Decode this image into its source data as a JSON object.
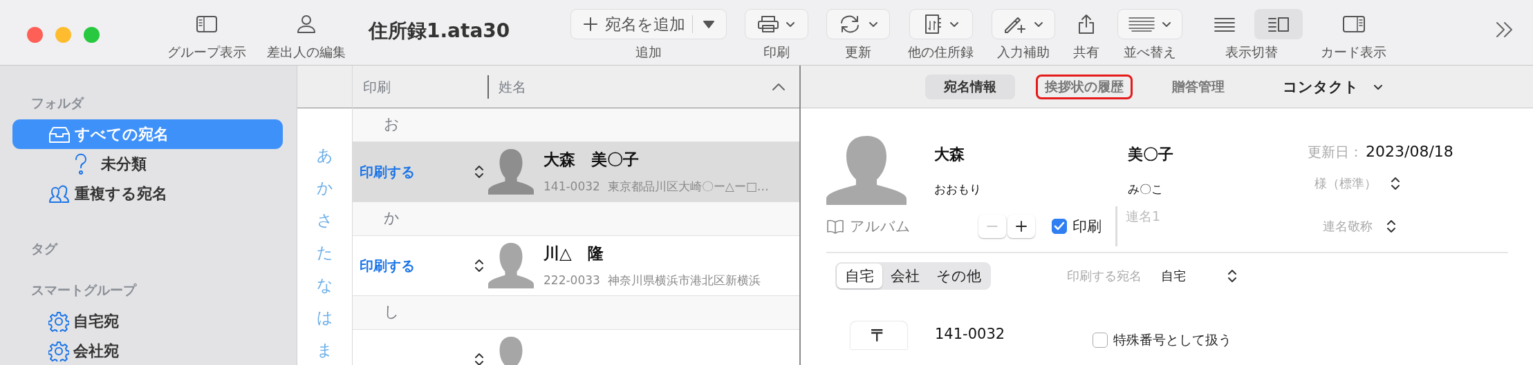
{
  "window": {
    "title": "住所録1.ata30"
  },
  "toolbar": {
    "left_items": [
      {
        "label": "グループ表示"
      },
      {
        "label": "差出人の編集"
      }
    ],
    "items": [
      {
        "kind": "split",
        "button_label": "宛名を追加",
        "label": "追加"
      },
      {
        "kind": "menu",
        "label": "印刷"
      },
      {
        "kind": "menu",
        "label": "更新"
      },
      {
        "kind": "menu",
        "label": "他の住所録"
      },
      {
        "kind": "menu",
        "label": "入力補助"
      },
      {
        "kind": "plain",
        "label": "共有"
      },
      {
        "kind": "menu",
        "label": "並べ替え"
      },
      {
        "kind": "toggle",
        "label": "表示切替",
        "segments": [
          {
            "selected": false
          },
          {
            "selected": true
          }
        ]
      },
      {
        "kind": "plain",
        "label": "カード表示"
      }
    ]
  },
  "sidebar": {
    "sections": [
      {
        "heading": "フォルダ",
        "items": [
          {
            "kind": "all",
            "label": "すべての宛名",
            "selected": true,
            "children": [
              {
                "kind": "unfiled",
                "label": "未分類",
                "selected": false
              }
            ]
          },
          {
            "kind": "duplicates",
            "label": "重複する宛名",
            "selected": false
          }
        ]
      },
      {
        "heading": "タグ"
      },
      {
        "heading": "スマートグループ",
        "items": [
          {
            "kind": "smart",
            "label": "自宅宛",
            "selected": false
          },
          {
            "kind": "smart",
            "label": "会社宛",
            "selected": false
          }
        ]
      }
    ]
  },
  "index_bar": {
    "letters": [
      "あ",
      "か",
      "さ",
      "た",
      "な",
      "は",
      "ま"
    ]
  },
  "list": {
    "columns": [
      "印刷",
      "姓名"
    ],
    "groups": [
      {
        "letter": "お",
        "rows": [
          {
            "print": "印刷する",
            "name": "大森　美〇子",
            "address": "141-0032  東京都品川区大崎〇ー△ー□…",
            "selected": true
          }
        ]
      },
      {
        "letter": "か",
        "rows": [
          {
            "print": "印刷する",
            "name": "川△　隆",
            "address": "222-0033  神奈川県横浜市港北区新横浜",
            "selected": false
          }
        ]
      },
      {
        "letter": "し",
        "rows": [
          {
            "selected": false
          }
        ]
      }
    ]
  },
  "detail": {
    "tabs": [
      {
        "kind": "tab",
        "label": "宛名情報",
        "selected": true,
        "highlighted": false
      },
      {
        "kind": "tab",
        "label": "挨拶状の履歴",
        "selected": false,
        "highlighted": true
      },
      {
        "kind": "tab",
        "label": "贈答管理",
        "selected": false,
        "highlighted": false
      },
      {
        "kind": "menu",
        "label": "コンタクト",
        "selected": false
      }
    ],
    "last_name": "大森",
    "first_name": "美〇子",
    "last_kana": "おおもり",
    "first_kana": "み〇こ",
    "updated_label": "更新日：",
    "updated": "2023/08/18",
    "honorific": "様（標準）",
    "album": "アルバム",
    "print_checkbox": {
      "label": "印刷",
      "checked": true
    },
    "joint_name": {
      "placeholder": "連名1"
    },
    "joint_honorific": "連名敬称",
    "address_tabs": [
      {
        "label": "自宅",
        "selected": true
      },
      {
        "label": "会社",
        "selected": false
      },
      {
        "label": "その他",
        "selected": false
      }
    ],
    "print_address": {
      "label": "印刷する宛名",
      "value": "自宅"
    },
    "postal_button": "〒",
    "postal_code": "141-0032",
    "special_number": {
      "label": "特殊番号として扱う",
      "checked": false
    }
  }
}
